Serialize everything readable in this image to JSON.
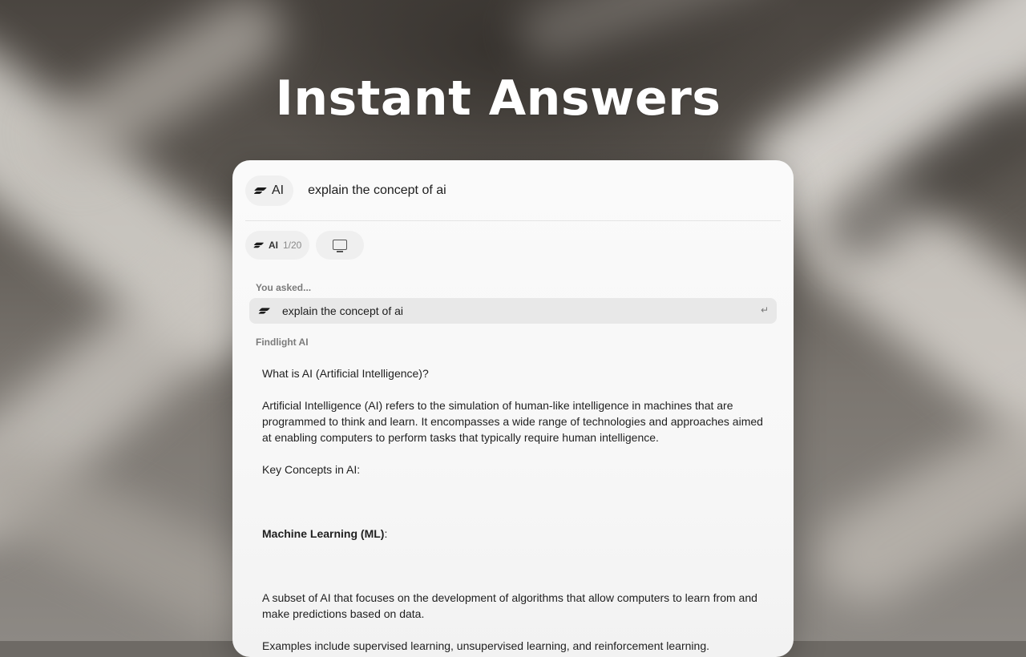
{
  "headline": "Instant Answers",
  "search": {
    "mode_label": "AI",
    "mode_icon": "slash-logo-icon",
    "query": "explain the concept of ai"
  },
  "toolbar": {
    "ai_label": "AI",
    "ai_count": "1/20",
    "screen_icon": "monitor-icon"
  },
  "you_asked": {
    "label": "You asked...",
    "question": "explain the concept of ai",
    "enter_icon": "return-icon"
  },
  "answer": {
    "label": "Findlight AI",
    "heading": "What is AI (Artificial Intelligence)?",
    "intro": "Artificial Intelligence (AI) refers to the simulation of human-like intelligence in machines that are programmed to think and learn. It encompasses a wide range of technologies and approaches aimed at enabling computers to perform tasks that typically require human intelligence.",
    "key_concepts": "Key Concepts in AI:",
    "ml_title": "Machine Learning (ML)",
    "ml_colon": ":",
    "ml_desc": "A subset of AI that focuses on the development of algorithms that allow computers to learn from and make predictions based on data.",
    "ml_examples": "Examples include supervised learning, unsupervised learning, and reinforcement learning."
  }
}
